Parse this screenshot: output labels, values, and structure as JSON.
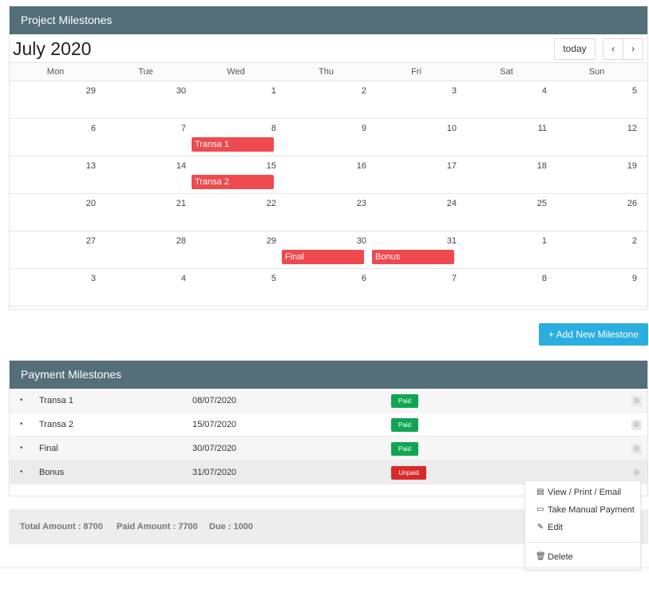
{
  "project": {
    "title": "Project Milestones",
    "month_title": "July 2020",
    "today_label": "today",
    "prev_label": "‹",
    "next_label": "›",
    "dow": [
      "Mon",
      "Tue",
      "Wed",
      "Thu",
      "Fri",
      "Sat",
      "Sun"
    ],
    "weeks": [
      [
        "29",
        "30",
        "1",
        "2",
        "3",
        "4",
        "5"
      ],
      [
        "6",
        "7",
        "8",
        "9",
        "10",
        "11",
        "12"
      ],
      [
        "13",
        "14",
        "15",
        "16",
        "17",
        "18",
        "19"
      ],
      [
        "20",
        "21",
        "22",
        "23",
        "24",
        "25",
        "26"
      ],
      [
        "27",
        "28",
        "29",
        "30",
        "31",
        "1",
        "2"
      ],
      [
        "3",
        "4",
        "5",
        "6",
        "7",
        "8",
        "9"
      ]
    ],
    "events": [
      {
        "label": "Transa 1",
        "week": 1,
        "day": 2
      },
      {
        "label": "Transa 2",
        "week": 2,
        "day": 2
      },
      {
        "label": "Final",
        "week": 4,
        "day": 3
      },
      {
        "label": "Bonus",
        "week": 4,
        "day": 4
      }
    ],
    "event_color": "#ef4a4f"
  },
  "add_button": {
    "icon": "plus-icon",
    "label": "+  Add New Milestone"
  },
  "payments": {
    "title": "Payment Milestones",
    "rows": [
      {
        "bullet": "•",
        "name": "Transa 1",
        "date": "08/07/2020",
        "status": "Paid"
      },
      {
        "bullet": "•",
        "name": "Transa 2",
        "date": "15/07/2020",
        "status": "Paid"
      },
      {
        "bullet": "•",
        "name": "Final",
        "date": "30/07/2020",
        "status": "Paid"
      },
      {
        "bullet": "•",
        "name": "Bonus",
        "date": "31/07/2020",
        "status": "Unpaid"
      }
    ]
  },
  "totals": {
    "total": "Total Amount : 8700",
    "paid": "Paid Amount : 7700",
    "due": "Due : 1000"
  },
  "menu": {
    "items": [
      {
        "icon": "document-icon",
        "label": "View / Print / Email"
      },
      {
        "icon": "credit-card-icon",
        "label": "Take Manual Payment"
      },
      {
        "icon": "pencil-icon",
        "label": "Edit"
      },
      {
        "icon": "trash-icon",
        "label": "Delete"
      }
    ]
  },
  "colors": {
    "header": "#546e7a",
    "accent": "#2aaee0",
    "paid": "#0fa553",
    "unpaid": "#d82a2a"
  }
}
